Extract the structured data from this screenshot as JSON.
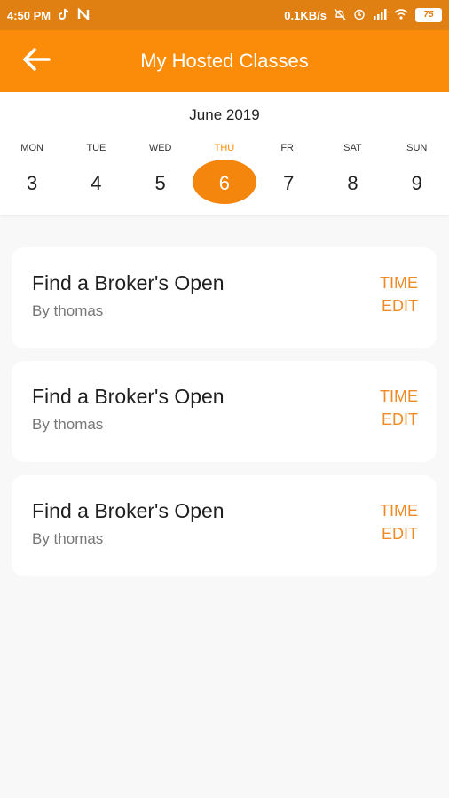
{
  "status_bar": {
    "time": "4:50 PM",
    "network_speed": "0.1KB/s",
    "battery": "75",
    "icons": [
      "tiktok-icon",
      "n-icon",
      "mute-icon",
      "alarm-icon",
      "signal-icon",
      "wifi-icon",
      "battery-icon"
    ]
  },
  "app_bar": {
    "title": "My Hosted Classes",
    "background": "#fb8c0a",
    "back_icon": "arrow-left-icon"
  },
  "calendar": {
    "month": "June 2019",
    "days": [
      {
        "name": "MON",
        "num": "3"
      },
      {
        "name": "TUE",
        "num": "4"
      },
      {
        "name": "WED",
        "num": "5"
      },
      {
        "name": "THU",
        "num": "6"
      },
      {
        "name": "FRI",
        "num": "7"
      },
      {
        "name": "SAT",
        "num": "8"
      },
      {
        "name": "SUN",
        "num": "9"
      }
    ],
    "selected_index": 3,
    "accent": "#f4850d"
  },
  "classes": [
    {
      "title": "Find a Broker's Open",
      "host": "By thomas",
      "time_label": "TIME",
      "edit_label": "EDIT"
    },
    {
      "title": "Find a Broker's Open",
      "host": "By thomas",
      "time_label": "TIME",
      "edit_label": "EDIT"
    },
    {
      "title": "Find a Broker's Open",
      "host": "By thomas",
      "time_label": "TIME",
      "edit_label": "EDIT"
    }
  ]
}
